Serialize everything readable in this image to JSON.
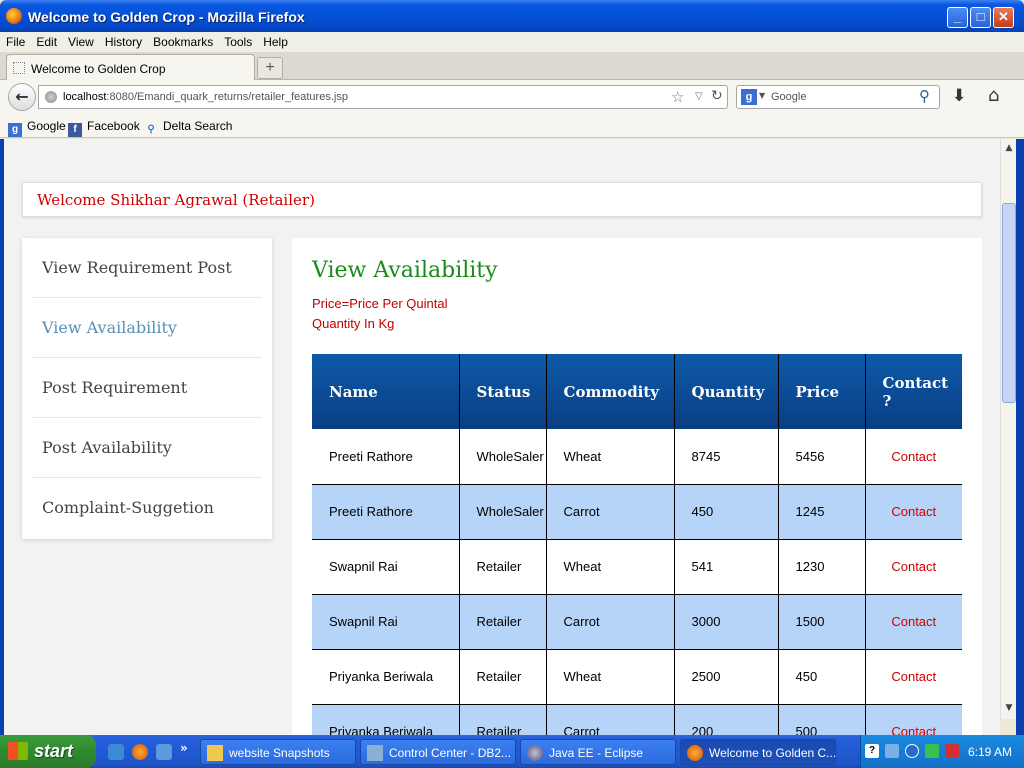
{
  "window": {
    "title": "Welcome to Golden Crop - Mozilla Firefox"
  },
  "menu": [
    "File",
    "Edit",
    "View",
    "History",
    "Bookmarks",
    "Tools",
    "Help"
  ],
  "tab": {
    "title": "Welcome to Golden Crop"
  },
  "nav": {
    "url_host": "localhost",
    "url_path": ":8080/Emandi_quark_returns/retailer_features.jsp",
    "search_placeholder": "Google"
  },
  "bookmarks": [
    "Google",
    "Facebook",
    "Delta Search"
  ],
  "page": {
    "welcome": "Welcome Shikhar Agrawal (Retailer)",
    "sidebar": [
      {
        "label": "View Requirement Post",
        "active": false
      },
      {
        "label": "View Availability",
        "active": true
      },
      {
        "label": "Post Requirement",
        "active": false
      },
      {
        "label": "Post Availability",
        "active": false
      },
      {
        "label": "Complaint-Suggetion",
        "active": false
      }
    ],
    "heading": "View Availability",
    "note1": "Price=Price Per Quintal",
    "note2": "Quantity In Kg",
    "table": {
      "headers": [
        "Name",
        "Status",
        "Commodity",
        "Quantity",
        "Price",
        "Contact ?"
      ],
      "rows": [
        [
          "Preeti Rathore",
          "WholeSaler",
          "Wheat",
          "8745",
          "5456",
          "Contact"
        ],
        [
          "Preeti Rathore",
          "WholeSaler",
          "Carrot",
          "450",
          "1245",
          "Contact"
        ],
        [
          "Swapnil Rai",
          "Retailer",
          "Wheat",
          "541",
          "1230",
          "Contact"
        ],
        [
          "Swapnil Rai",
          "Retailer",
          "Carrot",
          "3000",
          "1500",
          "Contact"
        ],
        [
          "Priyanka Beriwala",
          "Retailer",
          "Wheat",
          "2500",
          "450",
          "Contact"
        ],
        [
          "Priyanka Beriwala",
          "Retailer",
          "Carrot",
          "200",
          "500",
          "Contact"
        ]
      ]
    }
  },
  "taskbar": {
    "start": "start",
    "items": [
      "website Snapshots",
      "Control Center - DB2...",
      "Java EE - Eclipse",
      "Welcome to Golden C..."
    ],
    "clock": "6:19 AM"
  }
}
